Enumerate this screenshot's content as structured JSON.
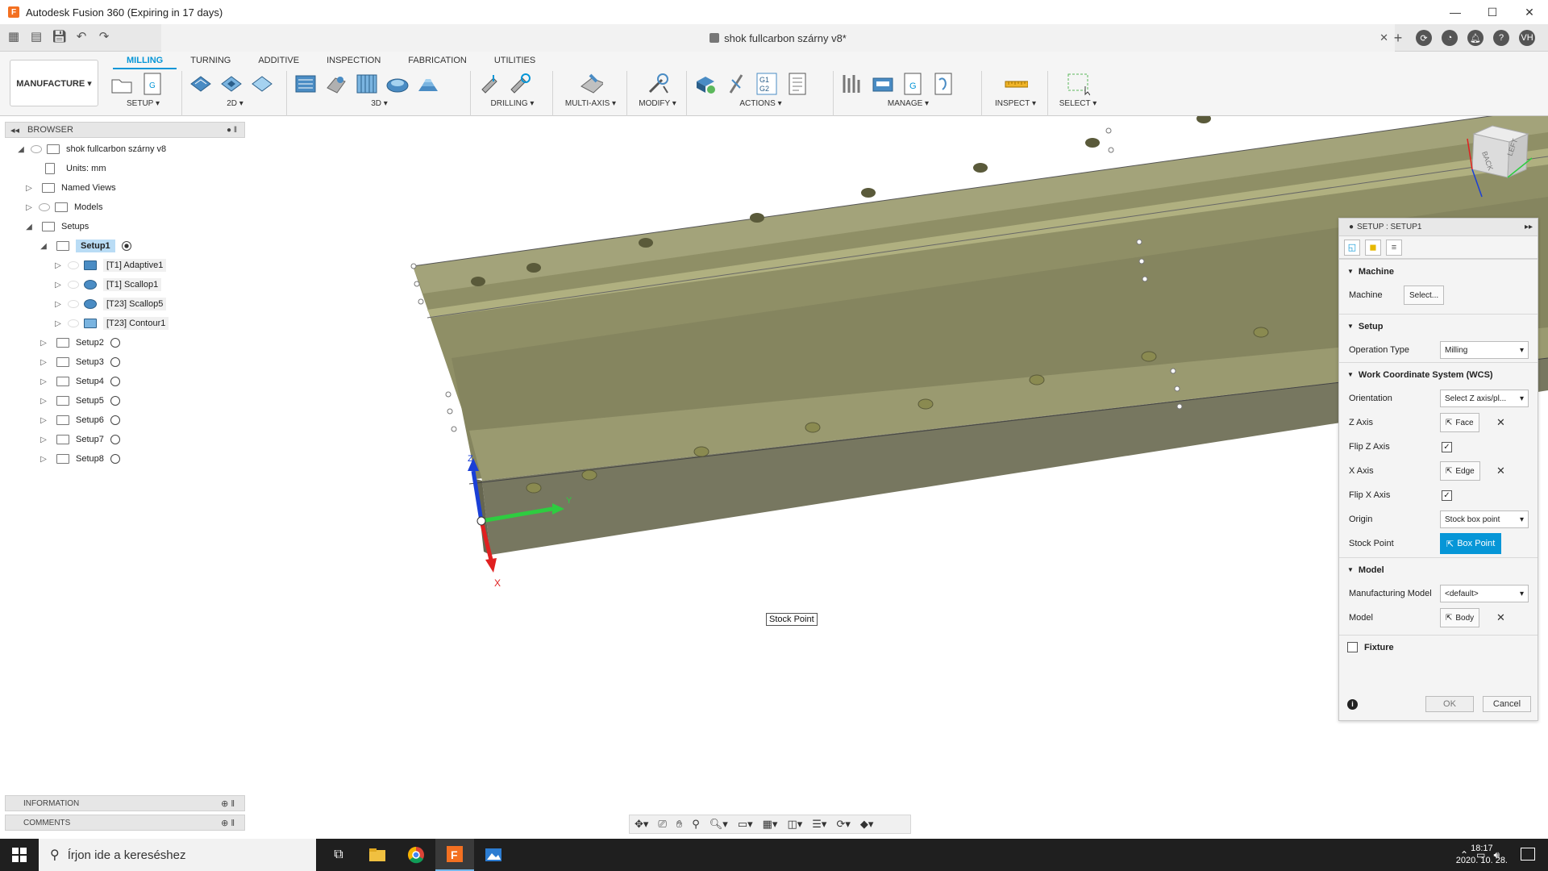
{
  "window": {
    "title": "Autodesk Fusion 360 (Expiring in 17 days)",
    "logo_letter": "F",
    "minimize": "—",
    "maximize": "☐",
    "close": "✕"
  },
  "document": {
    "tab_title": "shok fullcarbon szárny v8*",
    "close": "✕"
  },
  "user": {
    "initials": "VH"
  },
  "ribbon": {
    "workspace": "MANUFACTURE ▾",
    "tabs": [
      "MILLING",
      "TURNING",
      "ADDITIVE",
      "INSPECTION",
      "FABRICATION",
      "UTILITIES"
    ],
    "groups": {
      "setup": "SETUP ▾",
      "two_d": "2D ▾",
      "three_d": "3D ▾",
      "drilling": "DRILLING ▾",
      "multi_axis": "MULTI-AXIS ▾",
      "modify": "MODIFY ▾",
      "actions": "ACTIONS ▾",
      "manage": "MANAGE ▾",
      "inspect": "INSPECT ▾",
      "select": "SELECT ▾"
    },
    "g1g2_label": "G1\nG2",
    "g_label": "G"
  },
  "browser": {
    "header": "BROWSER",
    "root": "shok fullcarbon szárny v8",
    "units": "Units: mm",
    "named_views": "Named Views",
    "models": "Models",
    "setups": "Setups",
    "setup1": "Setup1",
    "operations": [
      "[T1] Adaptive1",
      "[T1] Scallop1",
      "[T23] Scallop5",
      "[T23] Contour1"
    ],
    "other_setups": [
      "Setup2",
      "Setup3",
      "Setup4",
      "Setup5",
      "Setup6",
      "Setup7",
      "Setup8"
    ]
  },
  "panels": {
    "information": "INFORMATION",
    "comments": "COMMENTS"
  },
  "viewport": {
    "tooltip": "Stock Point",
    "axis_x": "X",
    "axis_z": "Z",
    "axis_y": "Y",
    "viewcube_back": "BACK",
    "viewcube_left": "LEFT"
  },
  "dialog": {
    "title": "SETUP : SETUP1",
    "sections": {
      "machine": "Machine",
      "setup": "Setup",
      "wcs": "Work Coordinate System (WCS)",
      "model": "Model",
      "fixture": "Fixture"
    },
    "machine_label": "Machine",
    "machine_button": "Select...",
    "operation_type_label": "Operation Type",
    "operation_type_value": "Milling",
    "orientation_label": "Orientation",
    "orientation_value": "Select Z axis/pl...",
    "z_axis_label": "Z Axis",
    "z_axis_value": "Face",
    "flip_z_label": "Flip Z Axis",
    "x_axis_label": "X Axis",
    "x_axis_value": "Edge",
    "flip_x_label": "Flip X Axis",
    "origin_label": "Origin",
    "origin_value": "Stock box point",
    "stock_point_label": "Stock Point",
    "stock_point_value": "Box Point",
    "mfg_model_label": "Manufacturing Model",
    "mfg_model_value": "<default>",
    "model_label": "Model",
    "model_value": "Body",
    "ok": "OK",
    "cancel": "Cancel",
    "info": "i"
  },
  "taskbar": {
    "search_placeholder": "Írjon ide a kereséshez",
    "time": "18:17",
    "date": "2020. 10. 28."
  },
  "colors": {
    "accent": "#0696d7",
    "part_top": "#9c9c6e",
    "part_side": "#7a7a5a",
    "hole": "#5a5a3a"
  }
}
